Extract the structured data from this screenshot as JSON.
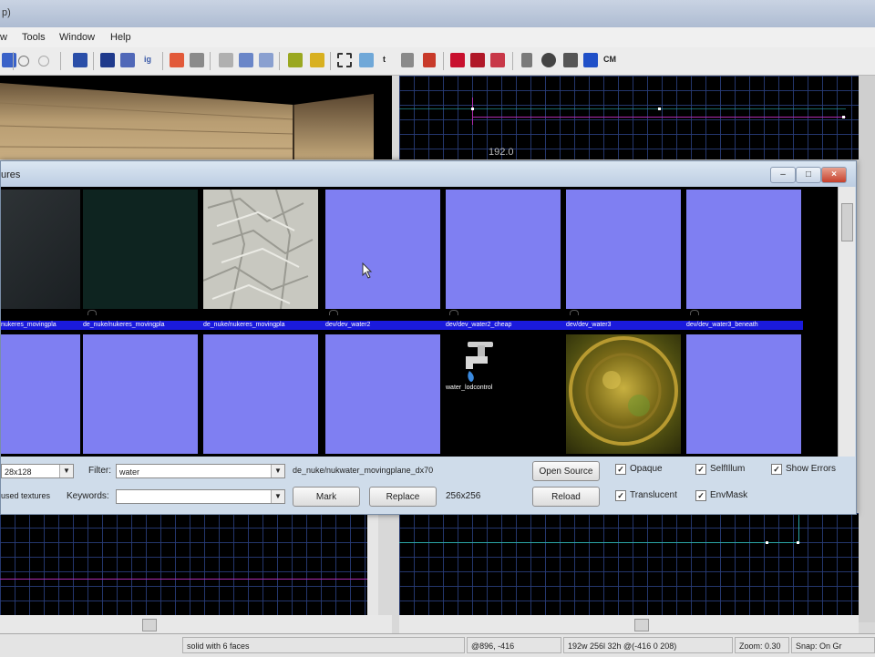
{
  "window": {
    "title_fragment": "p)"
  },
  "menu": {
    "items": [
      "w",
      "Tools",
      "Window",
      "Help"
    ]
  },
  "toolbar": {
    "cm_label": "CM",
    "ig_label": "ig",
    "t_label": "t"
  },
  "viewports": {
    "top_right_coordinate": "192.0"
  },
  "texture_browser": {
    "title": "ures",
    "window_buttons": [
      "–",
      "□",
      "×"
    ],
    "row1": [
      {
        "label": "nukeres_movingpla",
        "type": "dark-gray"
      },
      {
        "label": "de_nuke/nukeres_movingpla",
        "type": "dark-green"
      },
      {
        "label": "de_nuke/nukeres_movingpla",
        "type": "white-crumpled"
      },
      {
        "label": "dev/dev_water2",
        "type": "blue"
      },
      {
        "label": "dev/dev_water2_cheap",
        "type": "blue"
      },
      {
        "label": "dev/dev_water3",
        "type": "blue"
      },
      {
        "label": "dev/dev_water3_beneath",
        "type": "blue"
      }
    ],
    "row2": [
      {
        "label": "",
        "type": "blue"
      },
      {
        "label": "",
        "type": "blue"
      },
      {
        "label": "",
        "type": "blue"
      },
      {
        "label": "",
        "type": "blue"
      },
      {
        "label": "water_lodcontrol",
        "type": "faucet"
      },
      {
        "label": "",
        "type": "gold"
      },
      {
        "label": "",
        "type": "blue"
      }
    ],
    "controls": {
      "size_value": "28x128",
      "filter_label": "Filter:",
      "filter_value": "water",
      "selected_texture": "de_nuke/nukwater_movingplane_dx70",
      "open_source": "Open Source",
      "used_textures_label": "used textures",
      "keywords_label": "Keywords:",
      "keywords_value": "",
      "mark": "Mark",
      "replace": "Replace",
      "dimensions": "256x256",
      "reload": "Reload",
      "opaque": "Opaque",
      "selfillum": "SelfIllum",
      "show_errors": "Show Errors",
      "translucent": "Translucent",
      "envmask": "EnvMask",
      "check_mark": "✓"
    }
  },
  "statusbar": {
    "selection": "solid with 6 faces",
    "coords": "@896, -416",
    "size": "192w 256l 32h @(-416 0 208)",
    "zoom": "Zoom: 0.30",
    "snap": "Snap: On Gr"
  },
  "colors": {
    "texture_blue": "#7f7ff2",
    "label_strip": "#1a1adc",
    "grid_line": "#283c78",
    "magenta_line": "#b02cb0",
    "teal_line": "#2aa6a6"
  }
}
